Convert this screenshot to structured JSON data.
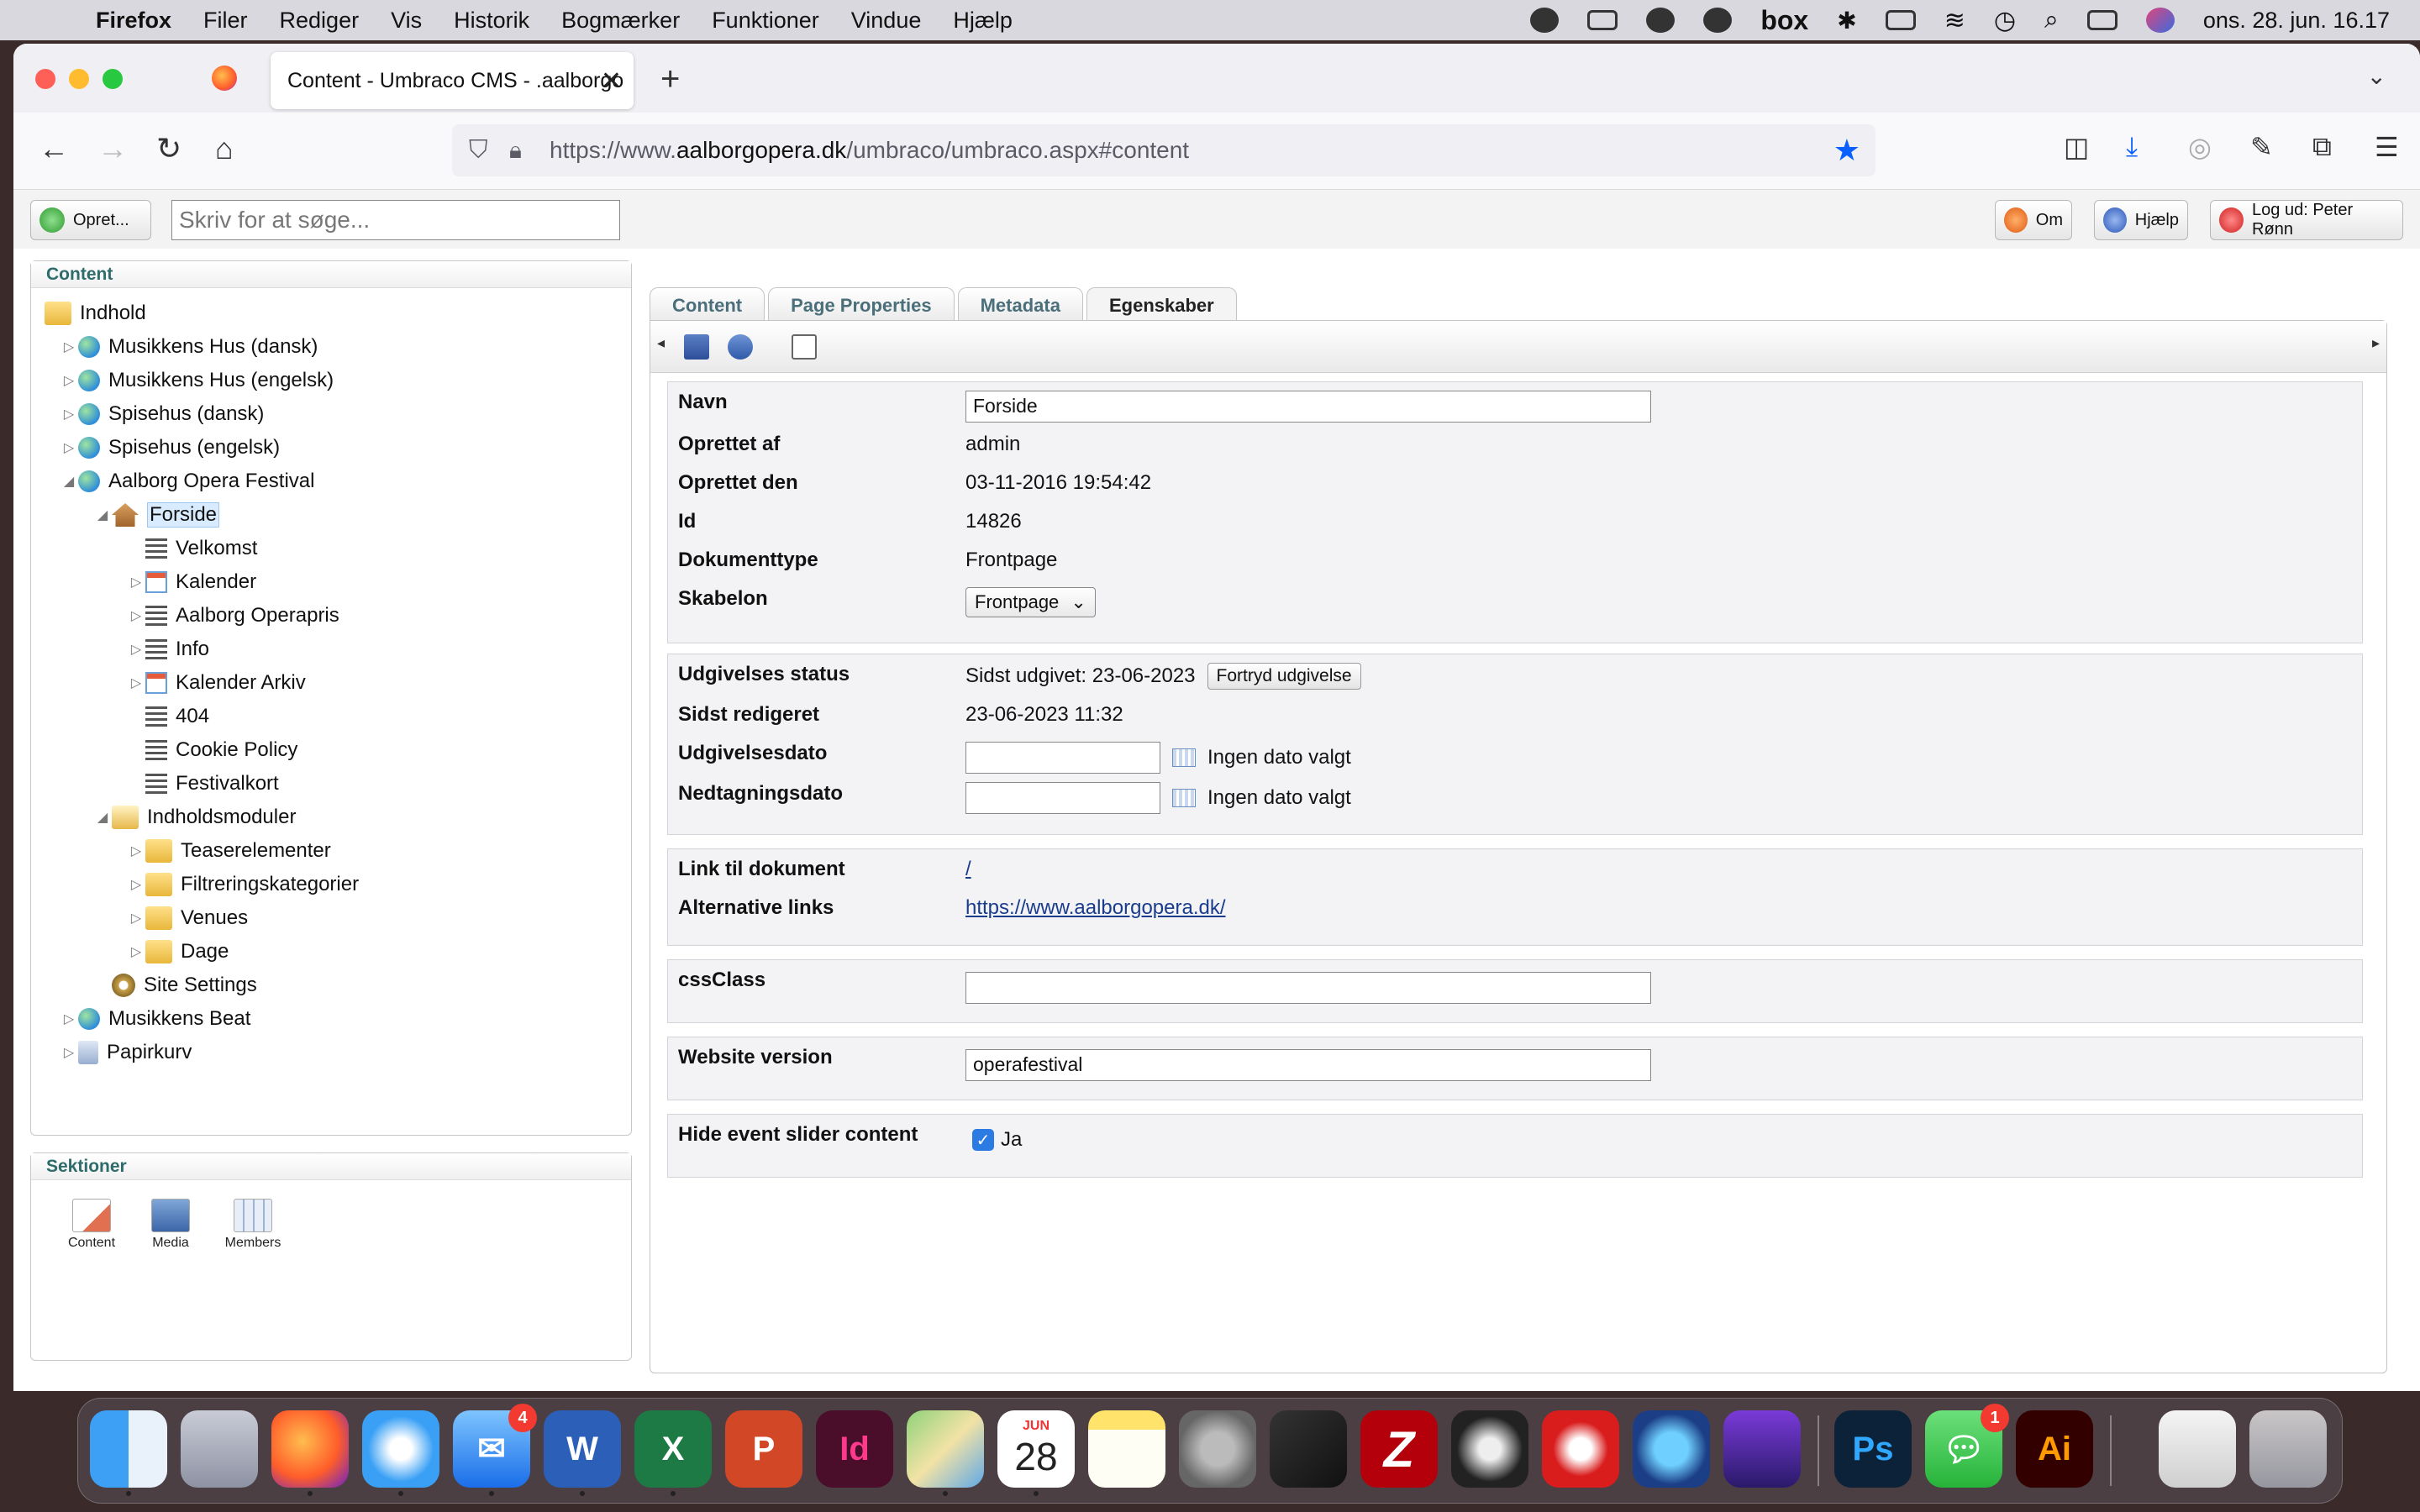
{
  "menubar": {
    "app": "Firefox",
    "items": [
      "Filer",
      "Rediger",
      "Vis",
      "Historik",
      "Bogmærker",
      "Funktioner",
      "Vindue",
      "Hjælp"
    ],
    "status_box": "box",
    "clock": "ons. 28. jun.  16.17"
  },
  "browser": {
    "tab_title": "Content - Umbraco CMS - .aalborgo",
    "url_prefix": "https://www.",
    "url_host": "aalborgopera.dk",
    "url_path": "/umbraco/umbraco.aspx#content"
  },
  "topbar": {
    "create_label": "Opret...",
    "search_placeholder": "Skriv for at søge...",
    "about_label": "Om",
    "help_label": "Hjælp",
    "logout_label": "Log ud: Peter Rønn"
  },
  "content_panel": {
    "title": "Content",
    "tree": [
      {
        "label": "Indhold",
        "icon": "folder-icon"
      },
      {
        "label": "Musikkens Hus (dansk)",
        "icon": "globe-icon"
      },
      {
        "label": "Musikkens Hus (engelsk)",
        "icon": "globe-icon"
      },
      {
        "label": "Spisehus (dansk)",
        "icon": "globe-icon"
      },
      {
        "label": "Spisehus (engelsk)",
        "icon": "globe-icon"
      },
      {
        "label": "Aalborg Opera Festival",
        "icon": "globe-icon"
      },
      {
        "label": "Forside",
        "icon": "house-icon"
      },
      {
        "label": "Velkomst",
        "icon": "document-icon"
      },
      {
        "label": "Kalender",
        "icon": "calendar-icon"
      },
      {
        "label": "Aalborg Operapris",
        "icon": "document-icon"
      },
      {
        "label": "Info",
        "icon": "document-icon"
      },
      {
        "label": "Kalender Arkiv",
        "icon": "calendar-icon"
      },
      {
        "label": "404",
        "icon": "document-icon"
      },
      {
        "label": "Cookie Policy",
        "icon": "document-icon"
      },
      {
        "label": "Festivalkort",
        "icon": "document-icon"
      },
      {
        "label": "Indholdsmoduler",
        "icon": "open-folder-icon"
      },
      {
        "label": "Teaserelementer",
        "icon": "folder-icon"
      },
      {
        "label": "Filtreringskategorier",
        "icon": "folder-icon"
      },
      {
        "label": "Venues",
        "icon": "folder-icon"
      },
      {
        "label": "Dage",
        "icon": "folder-icon"
      },
      {
        "label": "Site Settings",
        "icon": "gear-icon"
      },
      {
        "label": "Musikkens Beat",
        "icon": "globe-icon"
      },
      {
        "label": "Papirkurv",
        "icon": "recycle-bin-icon"
      }
    ]
  },
  "sections_panel": {
    "title": "Sektioner",
    "items": [
      "Content",
      "Media",
      "Members"
    ]
  },
  "editor": {
    "tabs": [
      "Content",
      "Page Properties",
      "Metadata",
      "Egenskaber"
    ],
    "active_tab": "Egenskaber",
    "group1": {
      "navn_label": "Navn",
      "navn_value": "Forside",
      "oprettet_af_label": "Oprettet af",
      "oprettet_af_value": "admin",
      "oprettet_den_label": "Oprettet den",
      "oprettet_den_value": "03-11-2016 19:54:42",
      "id_label": "Id",
      "id_value": "14826",
      "dokumenttype_label": "Dokumenttype",
      "dokumenttype_value": "Frontpage",
      "skabelon_label": "Skabelon",
      "skabelon_value": "Frontpage"
    },
    "group2": {
      "status_label": "Udgivelses status",
      "status_value": "Sidst udgivet: 23-06-2023",
      "unpublish_label": "Fortryd udgivelse",
      "edited_label": "Sidst redigeret",
      "edited_value": "23-06-2023 11:32",
      "publish_date_label": "Udgivelsesdato",
      "publish_date_note": "Ingen dato valgt",
      "expire_date_label": "Nedtagningsdato",
      "expire_date_note": "Ingen dato valgt"
    },
    "group3": {
      "link_label": "Link til dokument",
      "link_value": "/",
      "alt_links_label": "Alternative links",
      "alt_links_value": "https://www.aalborgopera.dk/"
    },
    "group4": {
      "css_label": "cssClass",
      "css_value": ""
    },
    "group5": {
      "version_label": "Website version",
      "version_value": "operafestival"
    },
    "group6": {
      "slider_label": "Hide event slider content",
      "slider_checked": true,
      "slider_text": "Ja"
    }
  },
  "dock": {
    "mail_badge": "4",
    "messages_badge": "1",
    "calendar_month": "JUN",
    "calendar_day": "28"
  }
}
